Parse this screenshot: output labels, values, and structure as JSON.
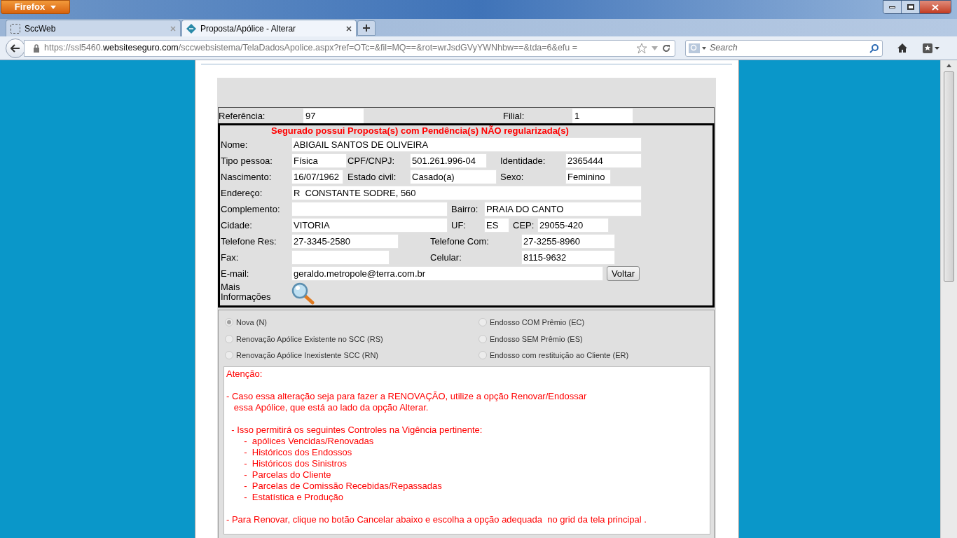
{
  "browser": {
    "menu_button": "Firefox",
    "tabs": [
      {
        "label": "SccWeb",
        "selected": false
      },
      {
        "label": "Proposta/Apólice - Alterar",
        "selected": true
      }
    ],
    "url": {
      "prefix": "https://ssl5460.",
      "domain": "websiteseguro.com",
      "path": "/sccwebsistema/TelaDadosApolice.aspx?ref=OTc=&fil=MQ==&rot=wrJsdGVyYWNhbw==&tda=6&efu ="
    },
    "search": {
      "placeholder": "Search"
    }
  },
  "header": {
    "referencia": {
      "label": "Referência:",
      "value": "97"
    },
    "filial": {
      "label": "Filial:",
      "value": "1"
    }
  },
  "warning": "Segurado possui Proposta(s) com Pendência(s) NÃO regularizada(s)",
  "rows": [
    [
      {
        "kind": "label",
        "text": "Nome:"
      },
      {
        "kind": "input",
        "value": "ABIGAIL SANTOS DE OLIVEIRA"
      }
    ],
    [
      {
        "kind": "label",
        "text": "Tipo pessoa:"
      },
      {
        "kind": "input",
        "value": "Física"
      },
      {
        "kind": "label",
        "text": "CPF/CNPJ:"
      },
      {
        "kind": "input",
        "value": "501.261.996-04"
      },
      {
        "kind": "label",
        "text": "Identidade:"
      },
      {
        "kind": "input",
        "value": "2365444"
      }
    ],
    [
      {
        "kind": "label",
        "text": "Nascimento:"
      },
      {
        "kind": "input",
        "value": "16/07/1962"
      },
      {
        "kind": "label",
        "text": "Estado civil:"
      },
      {
        "kind": "input",
        "value": "Casado(a)"
      },
      {
        "kind": "label",
        "text": "Sexo:"
      },
      {
        "kind": "input",
        "value": "Feminino"
      }
    ],
    [
      {
        "kind": "label",
        "text": "Endereço:"
      },
      {
        "kind": "input",
        "value": "R  CONSTANTE SODRE, 560"
      }
    ],
    [
      {
        "kind": "label",
        "text": "Complemento:"
      },
      {
        "kind": "input"
      },
      {
        "kind": "label",
        "text": "Bairro:"
      },
      {
        "kind": "input",
        "value": "PRAIA DO CANTO"
      }
    ],
    [
      {
        "kind": "label",
        "text": "Cidade:"
      },
      {
        "kind": "input",
        "value": "VITORIA"
      },
      {
        "kind": "label",
        "text": "UF:"
      },
      {
        "kind": "input",
        "value": "ES"
      },
      {
        "kind": "label",
        "text": "CEP:"
      },
      {
        "kind": "input",
        "value": "29055-420"
      }
    ],
    [
      {
        "kind": "label",
        "text": "Telefone Res:"
      },
      {
        "kind": "input",
        "value": "27-3345-2580"
      },
      {
        "kind": "label",
        "text": "Telefone Com:"
      },
      {
        "kind": "input",
        "value": "27-3255-8960"
      }
    ],
    [
      {
        "kind": "label",
        "text": "Fax:"
      },
      {
        "kind": "input"
      },
      {
        "kind": "label",
        "text": "Celular:"
      },
      {
        "kind": "input",
        "value": "8115-9632"
      }
    ],
    [
      {
        "kind": "label",
        "text": "E-mail:"
      },
      {
        "kind": "input",
        "value": "geraldo.metropole@terra.com.br"
      },
      {
        "kind": "button",
        "text": "Voltar"
      }
    ]
  ],
  "more_info": {
    "label": "Mais Informações"
  },
  "options": [
    {
      "label": "Nova (N)",
      "selected": true,
      "disabled": true
    },
    {
      "label": "Endosso COM Prêmio (EC)",
      "selected": false,
      "disabled": true
    },
    {
      "label": "Renovação Apólice Existente no SCC (RS)",
      "selected": false,
      "disabled": true
    },
    {
      "label": "Endosso SEM Prêmio (ES)",
      "selected": false,
      "disabled": true
    },
    {
      "label": "Renovação Apólice Inexistente SCC (RN)",
      "selected": false,
      "disabled": true
    },
    {
      "label": "Endosso com restituição ao Cliente (ER)",
      "selected": false,
      "disabled": true
    }
  ],
  "message": [
    [
      "Atenção:"
    ],
    [
      "- Caso essa alteração seja para fazer a RENOVAÇÃO, utilize a opção Renovar/Endossar",
      "   essa Apólice, que está ao lado da opção Alterar."
    ],
    [
      "  - Isso permitirá os seguintes Controles na Vigência pertinente:",
      "       -  apólices Vencidas/Renovadas",
      "       -  Históricos dos Endossos",
      "       -  Históricos dos Sinistros",
      "       -  Parcelas do Cliente",
      "       -  Parcelas de Comissão Recebidas/Repassadas",
      "       -  Estatística e Produção"
    ],
    [
      "- Para Renovar, clique no botão Cancelar abaixo e escolha a opção adequada  no grid da tela principal ."
    ]
  ]
}
